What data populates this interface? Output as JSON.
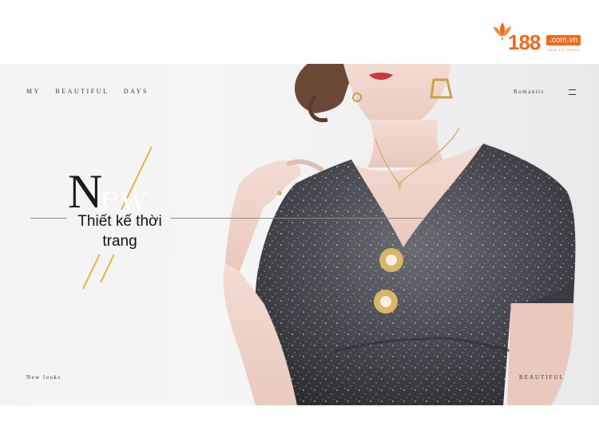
{
  "brand": {
    "logo_number": "188",
    "logo_domain": ".com.vn",
    "logo_tagline": "XEM LÀ THÍCH",
    "accent": "#ef6a21"
  },
  "banner": {
    "nav_left": [
      "MY",
      "BEAUTIFUL",
      "DAYS"
    ],
    "nav_right": "Romantic",
    "menu_icon": "hamburger-menu-icon",
    "big_first_letter": "N",
    "big_rest": "ew",
    "headline": "Thiết kế thời trang",
    "bottom_left": "New looks",
    "bottom_right": "BEAUTIFUL"
  }
}
